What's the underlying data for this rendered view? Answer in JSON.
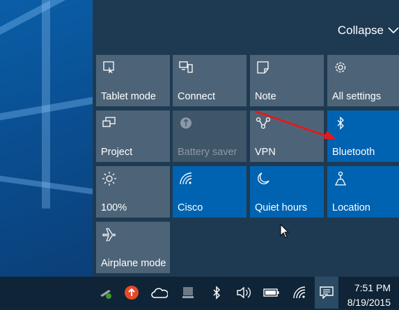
{
  "action_center": {
    "collapse_label": "Collapse",
    "tiles": [
      {
        "label": "Tablet mode",
        "icon": "tablet-mode-icon",
        "state": "off"
      },
      {
        "label": "Connect",
        "icon": "connect-icon",
        "state": "off"
      },
      {
        "label": "Note",
        "icon": "note-icon",
        "state": "off"
      },
      {
        "label": "All settings",
        "icon": "gear-icon",
        "state": "off"
      },
      {
        "label": "Project",
        "icon": "project-icon",
        "state": "off"
      },
      {
        "label": "Battery saver",
        "icon": "battery-saver-icon",
        "state": "disabled"
      },
      {
        "label": "VPN",
        "icon": "vpn-icon",
        "state": "off"
      },
      {
        "label": "Bluetooth",
        "icon": "bluetooth-icon",
        "state": "on"
      },
      {
        "label": "100%",
        "icon": "brightness-icon",
        "state": "off"
      },
      {
        "label": "Cisco",
        "icon": "wifi-icon",
        "state": "on"
      },
      {
        "label": "Quiet hours",
        "icon": "moon-icon",
        "state": "on"
      },
      {
        "label": "Location",
        "icon": "location-icon",
        "state": "on"
      },
      {
        "label": "Airplane mode",
        "icon": "airplane-icon",
        "state": "off"
      }
    ]
  },
  "taskbar": {
    "tray_icons": [
      "network-warning-icon",
      "upload-icon",
      "onedrive-icon",
      "device-icon",
      "bluetooth-icon",
      "volume-icon",
      "battery-icon",
      "wifi-icon",
      "notification-center-icon"
    ],
    "time": "7:51 PM",
    "date": "8/19/2015"
  },
  "colors": {
    "tile_on": "#0063b1",
    "tile_off": "#4d6478",
    "panel_bg": "#1e3a52",
    "taskbar_bg": "#0f2436",
    "annotation_arrow": "#e01b1b"
  }
}
